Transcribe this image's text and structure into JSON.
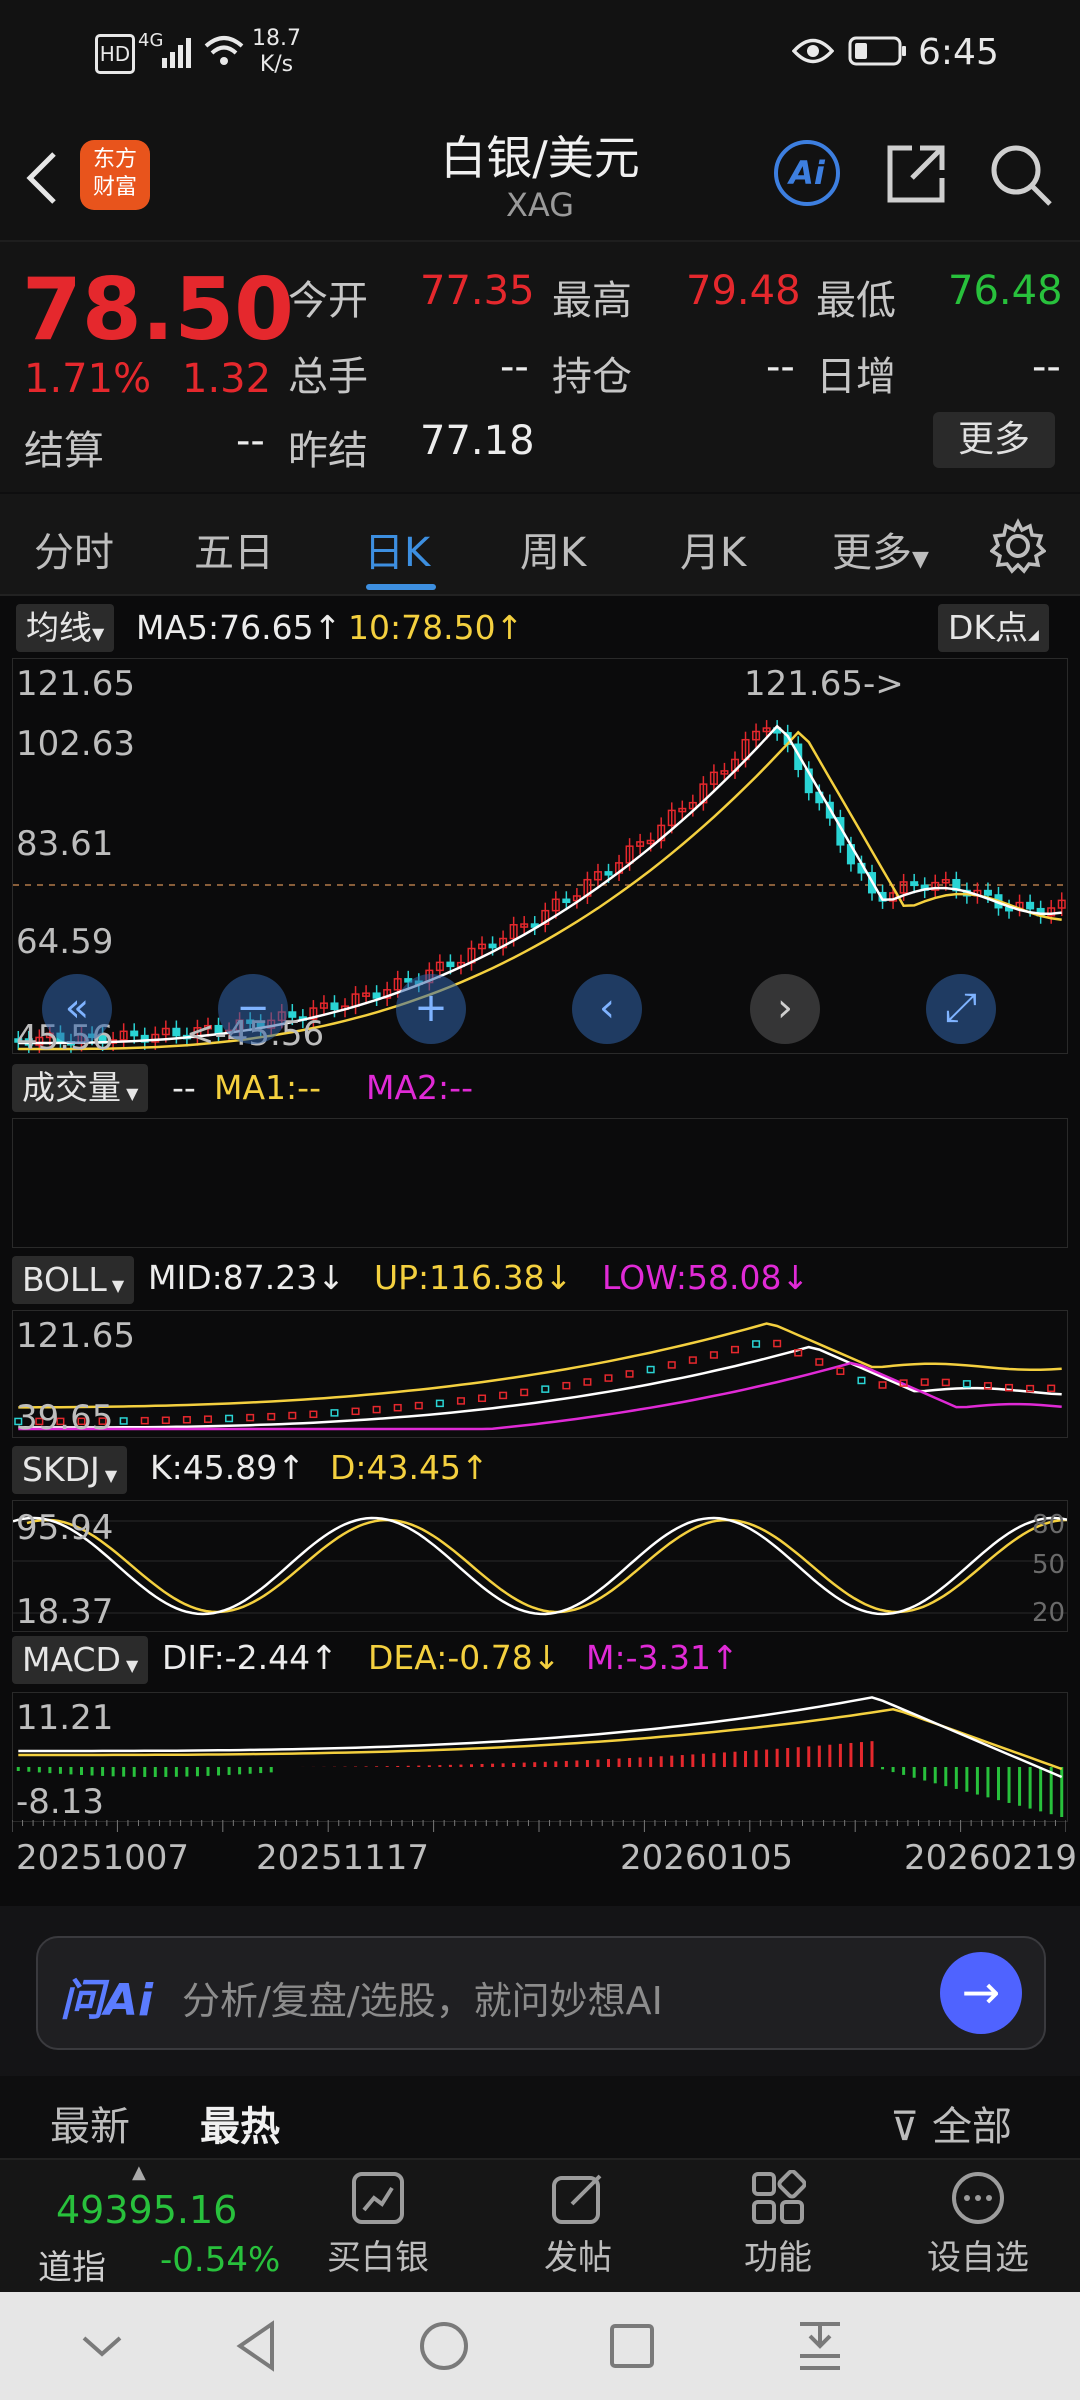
{
  "status_bar": {
    "hd": "HD",
    "network": "4G",
    "speed": "18.7",
    "speed_unit": "K/s",
    "time": "6:45",
    "icons": [
      "eye-icon",
      "battery-icon",
      "wifi-icon",
      "signal-icon"
    ]
  },
  "header": {
    "logo_line1": "东方",
    "logo_line2": "财富",
    "title": "白银/美元",
    "code": "XAG",
    "ai_label": "Ai"
  },
  "quote": {
    "price": "78.50",
    "change_pct": "1.71%",
    "change": "1.32",
    "open_label": "今开",
    "open": "77.35",
    "high_label": "最高",
    "high": "79.48",
    "low_label": "最低",
    "low": "76.48",
    "volume_label": "总手",
    "volume": "--",
    "position_label": "持仓",
    "position": "--",
    "daily_inc_label": "日增",
    "daily_inc": "--",
    "settle_label": "结算",
    "settle": "--",
    "prev_settle_label": "昨结",
    "prev_settle": "77.18",
    "more_label": "更多",
    "colors": {
      "up": "#e5282d",
      "down": "#28c13c"
    }
  },
  "tabs": [
    "分时",
    "五日",
    "日K",
    "周K",
    "月K",
    "更多"
  ],
  "active_tab": "日K",
  "ma": {
    "selector": "均线",
    "ma5": "MA5:76.65",
    "ma10": "10:78.50",
    "dk_label": "DK点",
    "y_ticks": [
      "121.65",
      "102.63",
      "83.61",
      "64.59",
      "45.56"
    ],
    "max_marker": "121.65->",
    "min_marker": "<-45.56"
  },
  "volume_panel": {
    "selector": "成交量",
    "dash": "--",
    "ma1": "MA1:--",
    "ma2": "MA2:--"
  },
  "boll": {
    "selector": "BOLL",
    "mid": "MID:87.23",
    "up": "UP:116.38",
    "low": "LOW:58.08",
    "y_top": "121.65",
    "y_bottom": "39.65"
  },
  "skdj": {
    "selector": "SKDJ",
    "k": "K:45.89",
    "d": "D:43.45",
    "y_top": "95.94",
    "y_bottom": "18.37",
    "levels": [
      "80",
      "50",
      "20"
    ]
  },
  "macd": {
    "selector": "MACD",
    "dif": "DIF:-2.44",
    "dea": "DEA:-0.78",
    "m": "M:-3.31",
    "y_top": "11.21",
    "y_bottom": "-8.13"
  },
  "x_dates": [
    "20251007",
    "20251117",
    "20260105",
    "20260219"
  ],
  "ask_ai": {
    "brand": "问Ai",
    "placeholder": "分析/复盘/选股，就问妙想AI"
  },
  "feed_tabs": [
    "最新",
    "最热",
    "全部"
  ],
  "bottom_bar": {
    "index_value": "49395.16",
    "index_name": "道指",
    "index_change": "-0.54%",
    "items": [
      "买白银",
      "发帖",
      "功能",
      "设自选"
    ]
  }
}
